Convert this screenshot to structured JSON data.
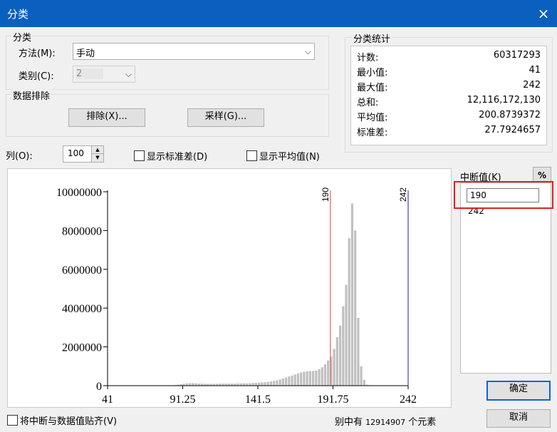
{
  "window": {
    "title": "分类",
    "close_icon": "×"
  },
  "classification": {
    "group_title": "分类",
    "method_label": "方法(M):",
    "method_value": "手动",
    "classes_label": "类别(C):",
    "classes_value": "2"
  },
  "exclusion": {
    "group_title": "数据排除",
    "exclude_button": "排除(X)...",
    "sampling_button": "采样(G)..."
  },
  "statistics": {
    "group_title": "分类统计",
    "rows": [
      {
        "key": "计数:",
        "value": "60317293"
      },
      {
        "key": "最小值:",
        "value": "41"
      },
      {
        "key": "最大值:",
        "value": "242"
      },
      {
        "key": "总和:",
        "value": "12,116,172,130"
      },
      {
        "key": "平均值:",
        "value": "200.8739372"
      },
      {
        "key": "标准差:",
        "value": "27.7924657"
      }
    ]
  },
  "options": {
    "columns_label": "列(O):",
    "columns_value": "100",
    "show_std_label": "显示标准差(D)",
    "show_std_checked": false,
    "show_mean_label": "显示平均值(N)",
    "show_mean_checked": false
  },
  "breaks": {
    "header_label": "中断值(K)",
    "percent_button": "%",
    "input_value": "190",
    "items": [
      "242"
    ]
  },
  "buttons": {
    "ok": "确定",
    "cancel": "取消"
  },
  "footer": {
    "snap_label": "将中断与数据值贴齐(V)",
    "snap_checked": false,
    "count_prefix": "别中有",
    "count_value": "12914907",
    "count_suffix": "个元素"
  },
  "chart_data": {
    "type": "bar",
    "title": "",
    "xlabel": "",
    "ylabel": "",
    "xlim": [
      41,
      242
    ],
    "ylim": [
      0,
      10000000
    ],
    "x_ticks": [
      "41",
      "91.25",
      "141.5",
      "191.75",
      "242"
    ],
    "y_ticks": [
      "0",
      "2000000",
      "4000000",
      "6000000",
      "8000000",
      "10000000"
    ],
    "grid": false,
    "break_lines": [
      {
        "value": 190,
        "label": "190",
        "color": "#e06060"
      },
      {
        "value": 242,
        "label": "242",
        "color": "#4040e0"
      }
    ],
    "bar_color": "#c0c0c0",
    "bin_edges_start": 41,
    "bin_width": 2.01,
    "values": [
      0,
      0,
      0,
      0,
      0,
      0,
      0,
      0,
      0,
      0,
      0,
      0,
      0,
      0,
      0,
      0,
      0,
      0,
      0,
      0,
      0,
      0,
      30000,
      50000,
      80000,
      100000,
      120000,
      130000,
      130000,
      120000,
      110000,
      110000,
      100000,
      100000,
      100000,
      100000,
      100000,
      110000,
      110000,
      110000,
      110000,
      110000,
      110000,
      120000,
      120000,
      120000,
      120000,
      130000,
      140000,
      150000,
      160000,
      170000,
      180000,
      200000,
      220000,
      250000,
      280000,
      320000,
      370000,
      420000,
      470000,
      520000,
      580000,
      630000,
      680000,
      720000,
      740000,
      750000,
      760000,
      780000,
      850000,
      950000,
      1100000,
      1300000,
      1500000,
      1900000,
      2500000,
      3100000,
      4100000,
      5200000,
      7600000,
      9400000,
      8000000,
      3500000,
      1000000,
      300000,
      50000,
      0,
      0,
      0,
      0,
      0,
      0,
      0,
      0,
      0,
      0,
      0,
      0,
      0
    ]
  }
}
